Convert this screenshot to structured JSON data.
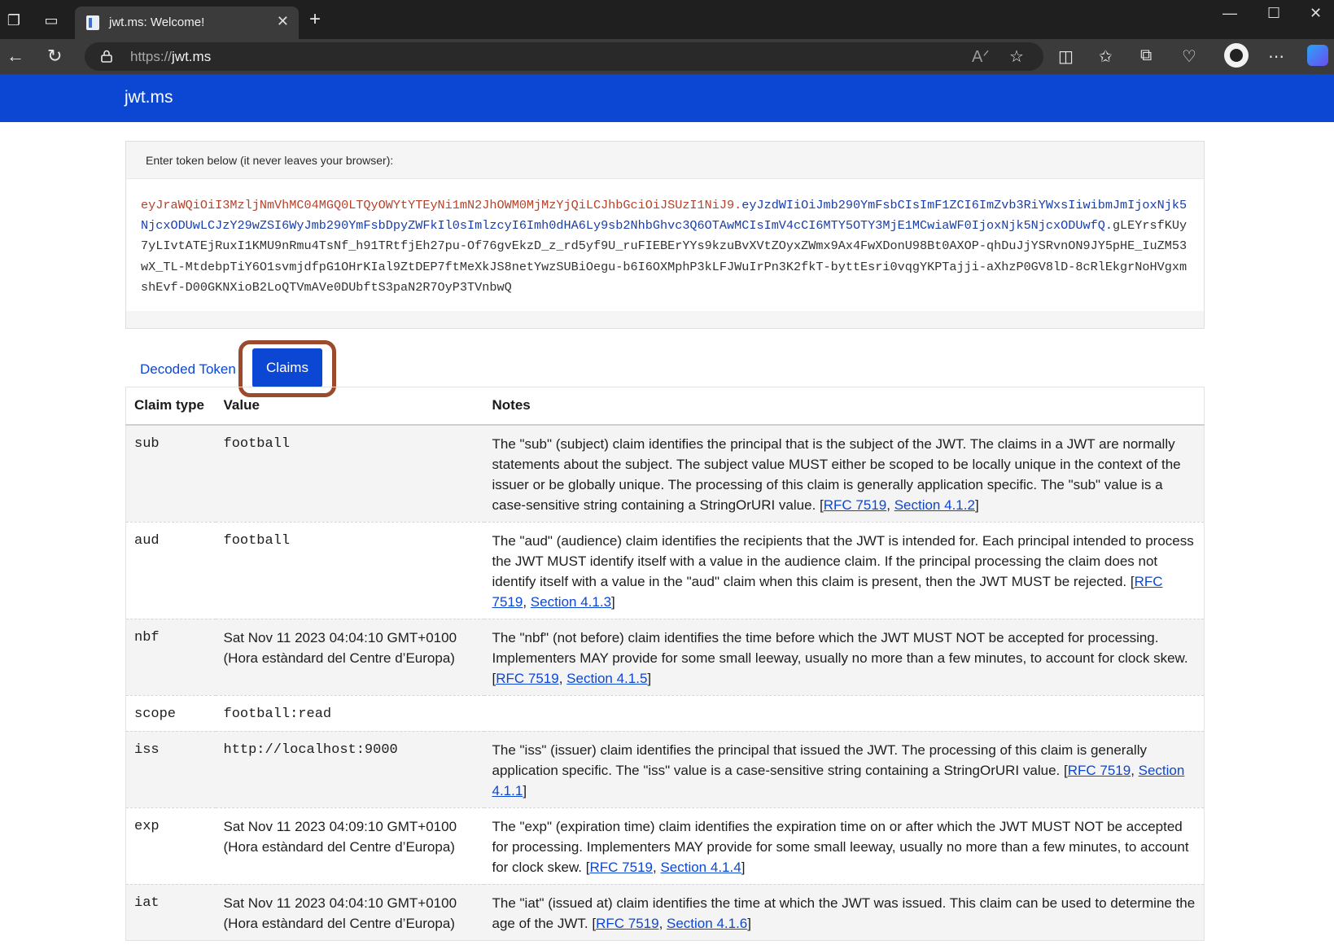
{
  "browser": {
    "tab_title": "jwt.ms: Welcome!",
    "url_protocol": "https://",
    "url_host": "jwt.ms"
  },
  "site": {
    "brand": "jwt.ms"
  },
  "token_card": {
    "label": "Enter token below (it never leaves your browser):",
    "header_part": "eyJraWQiOiI3MzljNmVhMC04MGQ0LTQyOWYtYTEyNi1mN2JhOWM0MjMzYjQiLCJhbGciOiJSUzI1NiJ9.",
    "payload_part": "eyJzdWIiOiJmb290YmFsbCIsImF1ZCI6ImZvb3RiYWxsIiwibmJmIjoxNjk5NjcxODUwLCJzY29wZSI6WyJmb290YmFsbDpyZWFkIl0sImlzcyI6Imh0dHA6Ly9sb2NhbGhvc3Q6OTAwMCIsImV4cCI6MTY5OTY3MjE1MCwiaWF0IjoxNjk5NjcxODUwfQ.",
    "signature_part": "gLEYrsfKUy7yLIvtATEjRuxI1KMU9nRmu4TsNf_h91TRtfjEh27pu-Of76gvEkzD_z_rd5yf9U_ruFIEBErYYs9kzuBvXVtZOyxZWmx9Ax4FwXDonU98Bt0AXOP-qhDuJjYSRvnON9JY5pHE_IuZM53wX_TL-MtdebpTiY6O1svmjdfpG1OHrKIal9ZtDEP7ftMeXkJS8netYwzSUBiOegu-b6I6OXMphP3kLFJWuIrPn3K2fkT-byttEsri0vqgYKPTajji-aXhzP0GV8lD-8cRlEkgrNoHVgxmshEvf-D00GKNXioB2LoQTVmAVe0DUbftS3paN2R7OyP3TVnbwQ"
  },
  "tabs": {
    "decoded": "Decoded Token",
    "claims": "Claims"
  },
  "table": {
    "headers": {
      "type": "Claim type",
      "value": "Value",
      "notes": "Notes"
    },
    "rfc_label": "RFC 7519",
    "rows": [
      {
        "type": "sub",
        "value": "football",
        "value_mono": true,
        "notes": "The \"sub\" (subject) claim identifies the principal that is the subject of the JWT. The claims in a JWT are normally statements about the subject. The subject value MUST either be scoped to be locally unique in the context of the issuer or be globally unique. The processing of this claim is generally application specific. The \"sub\" value is a case-sensitive string containing a StringOrURI value.",
        "section": "Section 4.1.2"
      },
      {
        "type": "aud",
        "value": "football",
        "value_mono": true,
        "notes": "The \"aud\" (audience) claim identifies the recipients that the JWT is intended for. Each principal intended to process the JWT MUST identify itself with a value in the audience claim. If the principal processing the claim does not identify itself with a value in the \"aud\" claim when this claim is present, then the JWT MUST be rejected.",
        "section": "Section 4.1.3"
      },
      {
        "type": "nbf",
        "value": "Sat Nov 11 2023 04:04:10 GMT+0100 (Hora estàndard del Centre d’Europa)",
        "value_mono": false,
        "notes": "The \"nbf\" (not before) claim identifies the time before which the JWT MUST NOT be accepted for processing. Implementers MAY provide for some small leeway, usually no more than a few minutes, to account for clock skew.",
        "section": "Section 4.1.5"
      },
      {
        "type": "scope",
        "value": "football:read",
        "value_mono": true,
        "notes": "",
        "section": ""
      },
      {
        "type": "iss",
        "value": "http://localhost:9000",
        "value_mono": true,
        "notes": "The \"iss\" (issuer) claim identifies the principal that issued the JWT. The processing of this claim is generally application specific. The \"iss\" value is a case-sensitive string containing a StringOrURI value.",
        "section": "Section 4.1.1"
      },
      {
        "type": "exp",
        "value": "Sat Nov 11 2023 04:09:10 GMT+0100 (Hora estàndard del Centre d’Europa)",
        "value_mono": false,
        "notes": "The \"exp\" (expiration time) claim identifies the expiration time on or after which the JWT MUST NOT be accepted for processing. Implementers MAY provide for some small leeway, usually no more than a few minutes, to account for clock skew.",
        "section": "Section 4.1.4"
      },
      {
        "type": "iat",
        "value": "Sat Nov 11 2023 04:04:10 GMT+0100 (Hora estàndard del Centre d’Europa)",
        "value_mono": false,
        "notes": "The \"iat\" (issued at) claim identifies the time at which the JWT was issued. This claim can be used to determine the age of the JWT.",
        "section": "Section 4.1.6"
      }
    ]
  }
}
